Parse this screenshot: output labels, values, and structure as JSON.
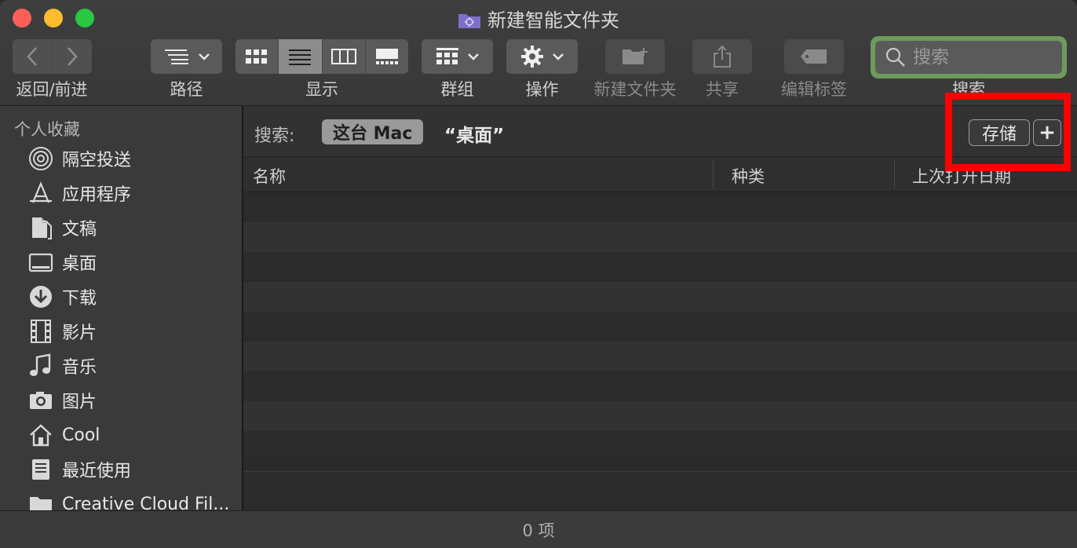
{
  "window": {
    "title": "新建智能文件夹"
  },
  "toolbar": {
    "back_forward_label": "返回/前进",
    "path_label": "路径",
    "view_label": "显示",
    "group_label": "群组",
    "action_label": "操作",
    "new_folder_label": "新建文件夹",
    "share_label": "共享",
    "edit_tags_label": "编辑标签",
    "search_label": "搜索",
    "search_placeholder": "搜索",
    "view_selected": "list"
  },
  "sidebar": {
    "heading": "个人收藏",
    "items": [
      {
        "label": "隔空投送",
        "icon": "airdrop-icon"
      },
      {
        "label": "应用程序",
        "icon": "applications-icon"
      },
      {
        "label": "文稿",
        "icon": "documents-icon"
      },
      {
        "label": "桌面",
        "icon": "desktop-icon"
      },
      {
        "label": "下载",
        "icon": "downloads-icon"
      },
      {
        "label": "影片",
        "icon": "movies-icon"
      },
      {
        "label": "音乐",
        "icon": "music-icon"
      },
      {
        "label": "图片",
        "icon": "pictures-icon"
      },
      {
        "label": "Cool",
        "icon": "home-icon"
      },
      {
        "label": "最近使用",
        "icon": "recents-icon"
      },
      {
        "label": "Creative Cloud Fil...",
        "icon": "folder-icon"
      }
    ]
  },
  "scope": {
    "label": "搜索:",
    "this_mac": "这台 Mac",
    "location": "“桌面”",
    "save_label": "存储",
    "add_label": "+"
  },
  "columns": {
    "name": "名称",
    "kind": "种类",
    "last_opened": "上次打开日期"
  },
  "status": {
    "item_count": "0 项"
  },
  "colors": {
    "highlight": "#ff0000",
    "search_focus": "#6f9a5d"
  }
}
